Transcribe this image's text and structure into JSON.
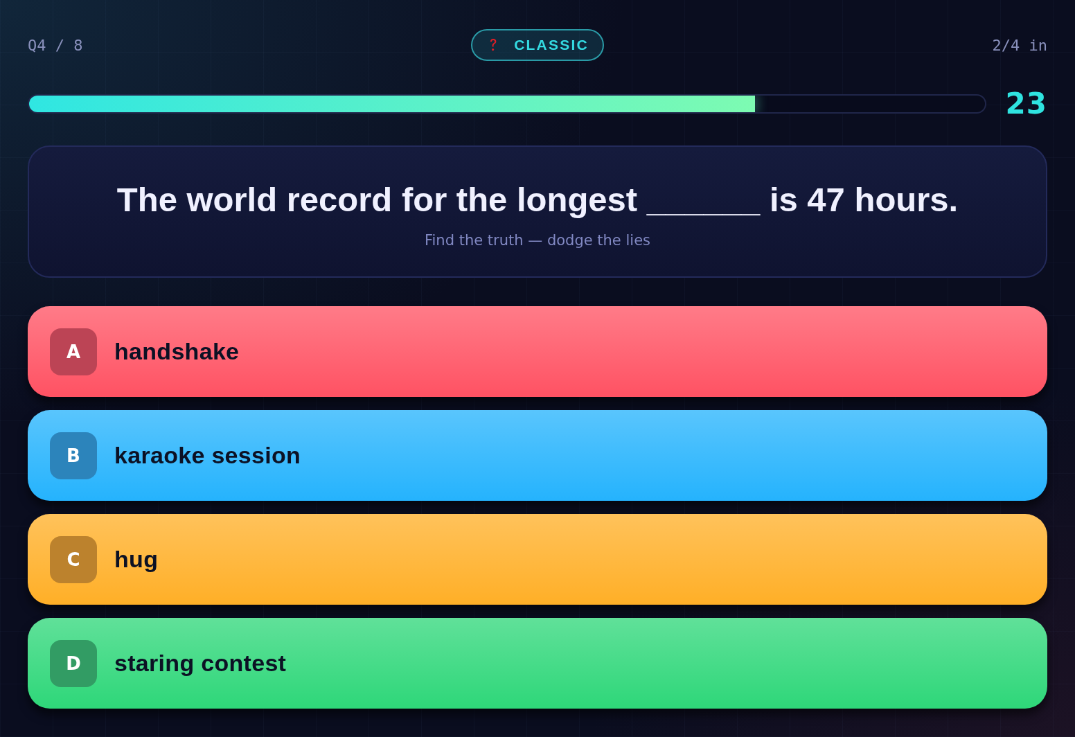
{
  "header": {
    "progress": "Q4 / 8",
    "mode": "CLASSIC",
    "answered": "2/4 in"
  },
  "timer": {
    "level": 0.76,
    "seconds": "23"
  },
  "question": {
    "text": "The world record for the longest ______ is 47 hours.",
    "hint": "Find the truth — dodge the lies"
  },
  "answers": [
    {
      "letter": "A",
      "text": "handshake",
      "color": "#ff5263"
    },
    {
      "letter": "B",
      "text": "karaoke session",
      "color": "#25b3fd"
    },
    {
      "letter": "C",
      "text": "hug",
      "color": "#ffaf27"
    },
    {
      "letter": "D",
      "text": "staring contest",
      "color": "#2ed779"
    }
  ]
}
